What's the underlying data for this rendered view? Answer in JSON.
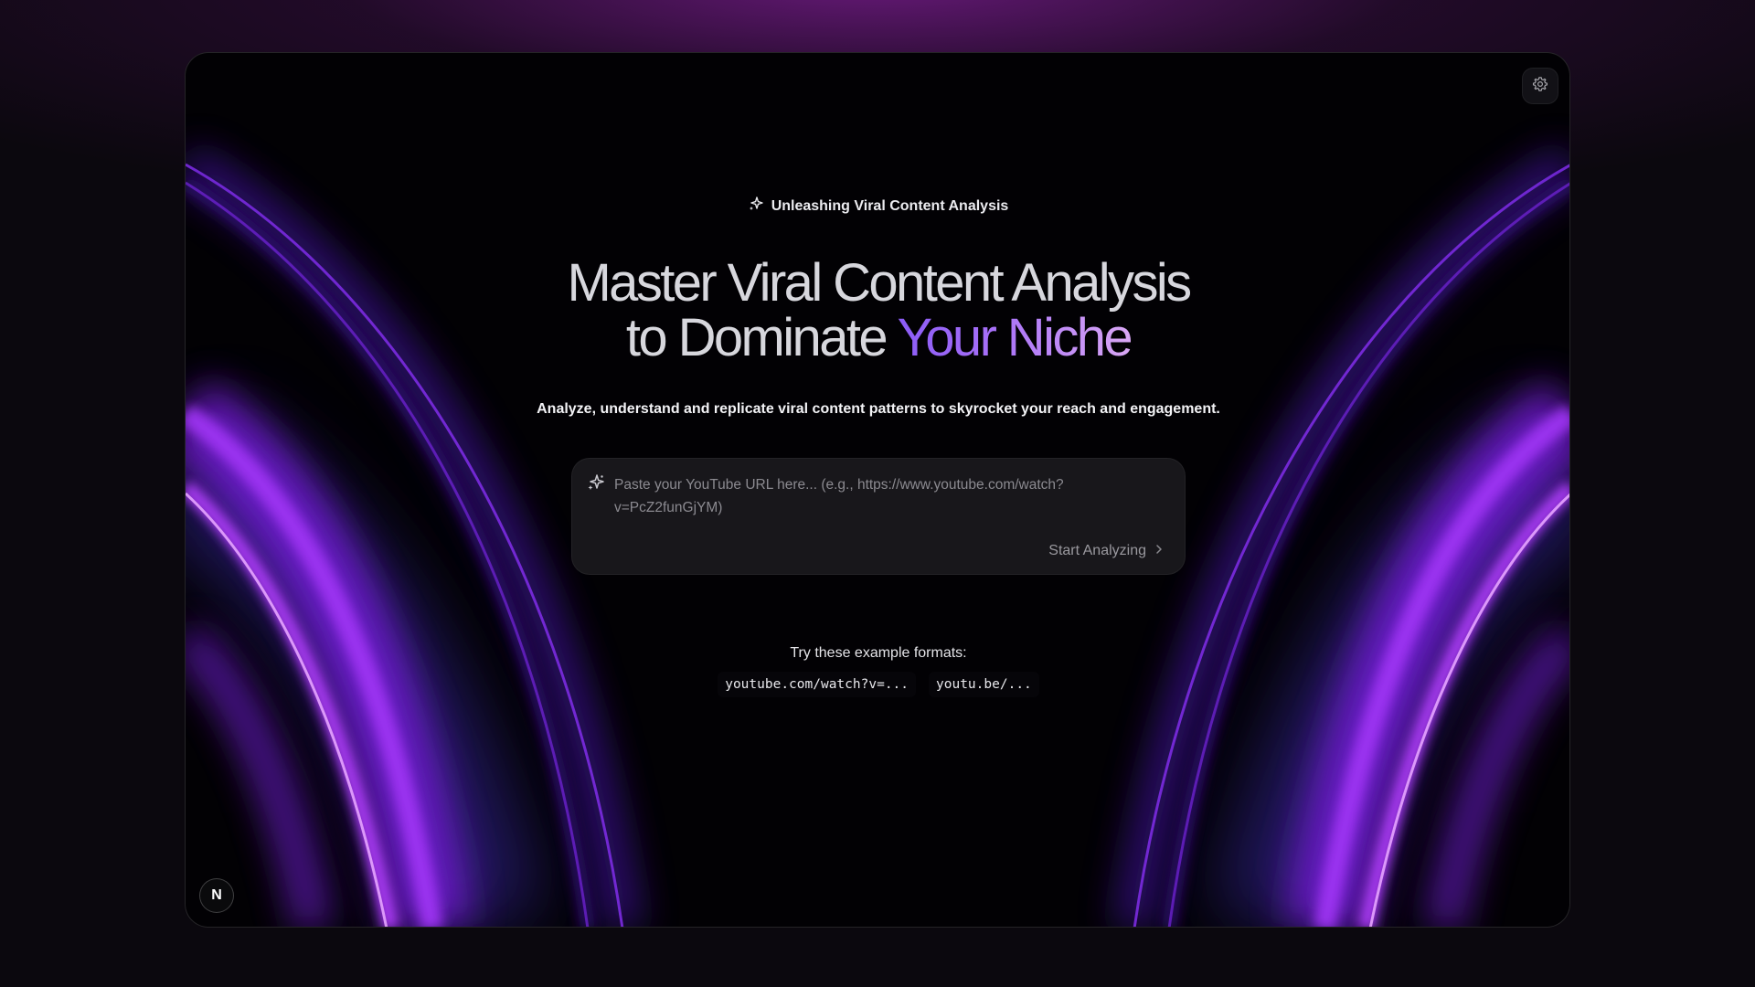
{
  "eyebrow": {
    "text": "Unleashing Viral Content Analysis",
    "icon": "sparkles-icon"
  },
  "headline": {
    "line1": "Master Viral Content Analysis",
    "line2_prefix": "to Dominate ",
    "line2_accent": "Your Niche"
  },
  "subtitle": "Analyze, understand and replicate viral content patterns to skyrocket your reach and engagement.",
  "search": {
    "placeholder": "Paste your YouTube URL here... (e.g., https://www.youtube.com/watch?v=PcZ2funGjYM)",
    "value": "",
    "button_label": "Start Analyzing",
    "button_icon": "chevron-right-icon"
  },
  "examples": {
    "label": "Try these example formats:",
    "items": [
      "youtube.com/watch?v=...",
      "youtu.be/..."
    ]
  },
  "badge": {
    "letter": "N"
  },
  "colors": {
    "accent_start": "#8b5cf6",
    "accent_end": "#d9a7f5",
    "arc_purple": "#9d2cf0",
    "background": "#020104"
  }
}
